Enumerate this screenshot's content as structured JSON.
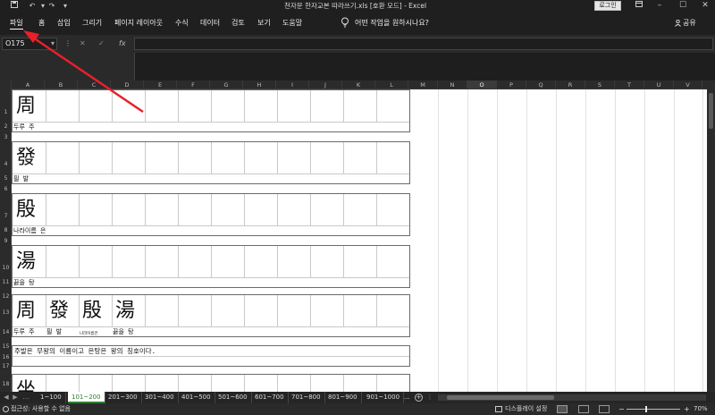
{
  "window": {
    "title": "천자문 한자교본 따라쓰기.xls  [호환 모드]  -  Excel",
    "login_label": "로그인"
  },
  "ribbon": {
    "tabs": [
      "파일",
      "홈",
      "삽입",
      "그리기",
      "페이지 레이아웃",
      "수식",
      "데이터",
      "검토",
      "보기",
      "도움말"
    ],
    "tell_me": "어떤 작업을 원하시나요?",
    "share": "공유"
  },
  "formula_bar": {
    "name_box": "O175",
    "formula": ""
  },
  "grid": {
    "columns": [
      "A",
      "B",
      "C",
      "D",
      "E",
      "F",
      "G",
      "H",
      "I",
      "J",
      "K",
      "L",
      "M",
      "N",
      "O",
      "P",
      "Q",
      "R",
      "S",
      "T",
      "U",
      "V"
    ],
    "selected_column": "O",
    "rows": [
      "1",
      "2",
      "3",
      "4",
      "5",
      "6",
      "7",
      "8",
      "9",
      "10",
      "11",
      "12",
      "13",
      "14",
      "15",
      "16",
      "17",
      "18"
    ],
    "blocks": [
      {
        "hanja": "周",
        "reading": "두루 주"
      },
      {
        "hanja": "發",
        "reading": "필 발"
      },
      {
        "hanja": "殷",
        "reading": "나라이름 은"
      },
      {
        "hanja": "湯",
        "reading": "끓을 탕"
      }
    ],
    "summary": [
      {
        "hanja": "周",
        "reading": "두루 주"
      },
      {
        "hanja": "發",
        "reading": "필 발"
      },
      {
        "hanja": "殷",
        "reading": "나라이름은"
      },
      {
        "hanja": "湯",
        "reading": "끓을 탕"
      }
    ],
    "sentence": "주발은 무왕의 이름이고 은탕은 왕의 칭호이다.",
    "partial_next": "坐"
  },
  "sheet_tabs": {
    "tabs": [
      "1~100",
      "101~200",
      "201~300",
      "301~400",
      "401~500",
      "501~600",
      "601~700",
      "701~800",
      "801~900",
      "901~1000"
    ],
    "active": "101~200",
    "more": "..."
  },
  "status": {
    "accessibility": "접근성: 사용할 수 없음",
    "display_settings": "디스플레이 설정",
    "zoom_minus": "−",
    "zoom_plus": "+",
    "zoom": "70%"
  },
  "colors": {
    "chrome": "#1f1f1f",
    "active_tab": "#2e7d32",
    "annotation_arrow": "#e8202a"
  }
}
